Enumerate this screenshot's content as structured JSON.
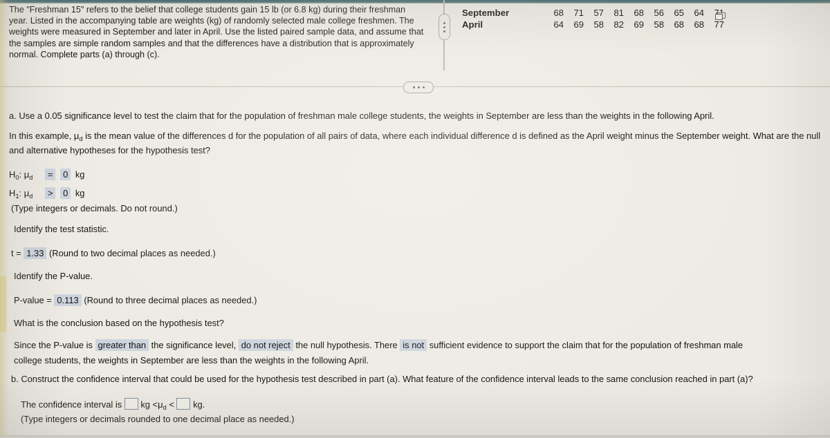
{
  "problem": {
    "statement": "The \"Freshman 15\" refers to the belief that college students gain 15 lb (or 6.8 kg) during their freshman year. Listed in the accompanying table are weights (kg) of randomly selected male college freshmen. The weights were measured in September and later in April. Use the listed paired sample data, and assume that the samples are simple random samples and that the differences have a distribution that is approximately normal. Complete parts (a) through (c)."
  },
  "data_table": {
    "rows": [
      {
        "label": "September",
        "values": [
          "68",
          "71",
          "57",
          "81",
          "68",
          "56",
          "65",
          "64",
          "71"
        ]
      },
      {
        "label": "April",
        "values": [
          "64",
          "69",
          "58",
          "82",
          "69",
          "58",
          "68",
          "68",
          "77"
        ]
      }
    ],
    "copy_icon": "copy-icon"
  },
  "divider": {
    "vertical_handle_icon": "drag-handle-vertical-icon",
    "horizontal_handle_icon": "ellipsis-icon"
  },
  "part_a": {
    "prompt": "a. Use a 0.05 significance level to test the claim that for the population of freshman male college students, the weights in September are less than the weights in the following April.",
    "explanation_1": "In this example, ",
    "explanation_mu": "μ",
    "explanation_mu_sub": "d",
    "explanation_2": " is the mean value of the differences d for the population of all pairs of data, where each individual difference d is defined as the April weight minus the September weight. What are the null and alternative hypotheses for the hypothesis test?",
    "h0_label": "H",
    "h0_sub": "0",
    "h0_mu": "μ",
    "h0_mu_sub": "d",
    "h0_operator": "=",
    "h0_value": "0",
    "h0_unit": "kg",
    "h1_label": "H",
    "h1_sub": "1",
    "h1_mu": "μ",
    "h1_mu_sub": "d",
    "h1_operator": ">",
    "h1_value": "0",
    "h1_unit": "kg",
    "hypothesis_note": "(Type integers or decimals. Do not round.)",
    "test_statistic_prompt": "Identify the test statistic.",
    "t_label": "t =",
    "t_value": "1.33",
    "t_note": "(Round to two decimal places as needed.)",
    "pvalue_prompt": "Identify the P-value.",
    "pvalue_label": "P-value =",
    "pvalue_value": "0.113",
    "pvalue_note": "(Round to three decimal places as needed.)",
    "conclusion_prompt": "What is the conclusion based on the hypothesis test?",
    "conclusion_1": "Since the P-value is",
    "conclusion_dropdown_1": "greater than",
    "conclusion_2": "the significance level,",
    "conclusion_dropdown_2": "do not reject",
    "conclusion_3": "the null hypothesis. There",
    "conclusion_dropdown_3": "is not",
    "conclusion_4": "sufficient evidence to support the claim that for the population of freshman male",
    "conclusion_5": "college students, the weights in September are less than the weights in the following April."
  },
  "part_b": {
    "prompt": "b. Construct the confidence interval that could be used for the hypothesis test described in part (a). What feature of the confidence interval leads to the same conclusion reached in part (a)?",
    "ci_text_1": "The confidence interval is",
    "ci_lower_value": "",
    "ci_unit_1": "kg <",
    "ci_mu": "μ",
    "ci_mu_sub": "d",
    "ci_lt": "<",
    "ci_upper_value": "",
    "ci_unit_2": "kg.",
    "ci_note": "(Type integers or decimals rounded to one decimal place as needed.)"
  },
  "colors": {
    "page_background": "#edebe3",
    "answer_highlight": "#ccd4de",
    "text": "#131313",
    "input_border": "#7f8ea3"
  }
}
